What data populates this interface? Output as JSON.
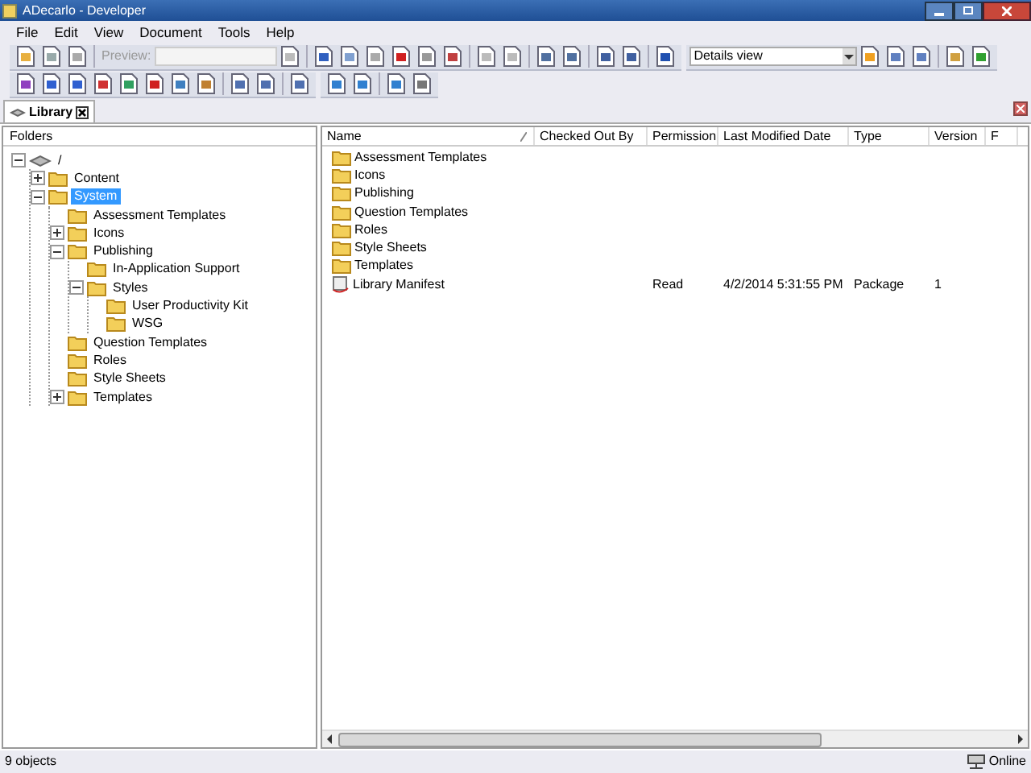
{
  "window": {
    "title": "ADecarlo - Developer"
  },
  "menu": [
    "File",
    "Edit",
    "View",
    "Document",
    "Tools",
    "Help"
  ],
  "toolbar": {
    "preview_label": "Preview:",
    "view_select": "Details view"
  },
  "tabs": [
    {
      "label": "Library",
      "selected": true
    }
  ],
  "folders_pane": {
    "title": "Folders",
    "tree": [
      {
        "label": "/",
        "kind": "drive",
        "expanded": true,
        "selected": false,
        "children": [
          {
            "label": "Content",
            "expanded": false,
            "selected": false
          },
          {
            "label": "System",
            "expanded": true,
            "selected": true,
            "children": [
              {
                "label": "Assessment Templates",
                "selected": false
              },
              {
                "label": "Icons",
                "expanded": false,
                "selected": false
              },
              {
                "label": "Publishing",
                "expanded": true,
                "selected": false,
                "children": [
                  {
                    "label": "In-Application Support",
                    "selected": false
                  },
                  {
                    "label": "Styles",
                    "expanded": true,
                    "selected": false,
                    "children": [
                      {
                        "label": "User Productivity Kit",
                        "selected": false
                      },
                      {
                        "label": "WSG",
                        "selected": false
                      }
                    ]
                  }
                ]
              },
              {
                "label": "Question Templates",
                "selected": false
              },
              {
                "label": "Roles",
                "selected": false
              },
              {
                "label": "Style Sheets",
                "selected": false
              },
              {
                "label": "Templates",
                "expanded": false,
                "selected": false
              }
            ]
          }
        ]
      }
    ]
  },
  "table": {
    "columns": [
      "Name",
      "Checked Out By",
      "Permission",
      "Last Modified Date",
      "Type",
      "Version",
      "F"
    ],
    "rows": [
      {
        "kind": "folder",
        "name": "Assessment Templates"
      },
      {
        "kind": "folder",
        "name": "Icons"
      },
      {
        "kind": "folder",
        "name": "Publishing"
      },
      {
        "kind": "folder",
        "name": "Question Templates"
      },
      {
        "kind": "folder",
        "name": "Roles"
      },
      {
        "kind": "folder",
        "name": "Style Sheets"
      },
      {
        "kind": "folder",
        "name": "Templates"
      },
      {
        "kind": "package",
        "name": "Library Manifest",
        "permission": "Read",
        "modified": "4/2/2014 5:31:55 PM",
        "type": "Package",
        "version": "1"
      }
    ]
  },
  "status_bar": {
    "count": "9 objects",
    "connection": "Online"
  }
}
